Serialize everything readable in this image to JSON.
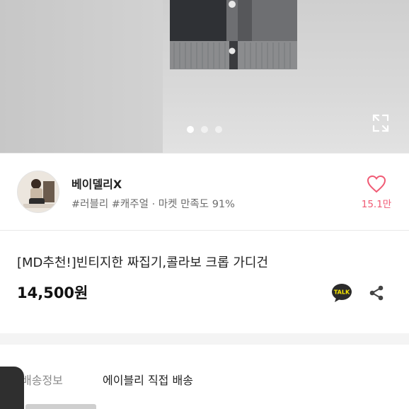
{
  "gallery": {
    "page_count": 3,
    "active_index": 0,
    "expand_icon": "expand-icon"
  },
  "seller": {
    "name": "베이델리X",
    "tags": "#러블리 #캐주얼",
    "separator": "·",
    "satisfaction": "마켓 만족도 91%",
    "like_count": "15.1만",
    "like_icon": "heart-outline-icon",
    "accent_color": "#f05a74"
  },
  "product": {
    "title": "[MD추천!]빈티지한 짜집기,콜라보 크롭 가디건",
    "price": "14,500원",
    "talk_label": "TALK",
    "share_icon": "share-icon"
  },
  "shipping": {
    "label": "배송정보",
    "value": "에이블리 직접 배송"
  }
}
